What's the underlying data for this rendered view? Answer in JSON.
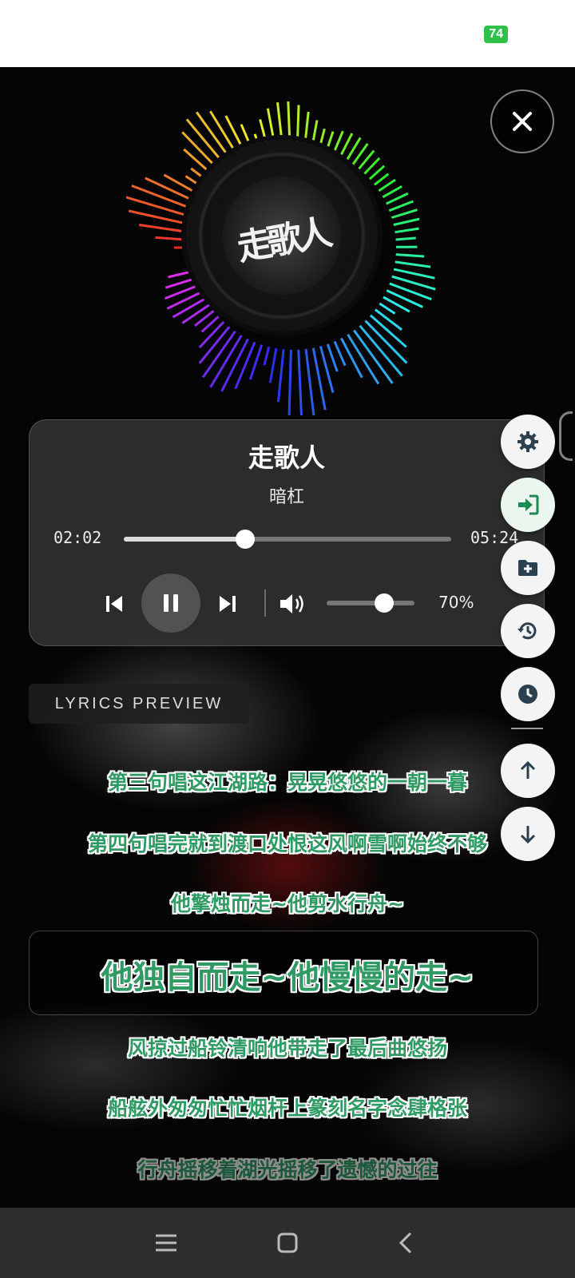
{
  "status_bar": {
    "battery": "74"
  },
  "album_art": {
    "text": "走歌人"
  },
  "player": {
    "title": "走歌人",
    "artist": "暗杠",
    "current_time": "02:02",
    "total_time": "05:24",
    "progress_fraction": 0.37,
    "volume_label": "70%",
    "volume_fraction": 0.65
  },
  "side_actions": [
    "settings",
    "login",
    "add-to-folder",
    "history",
    "timer",
    "scroll-up",
    "scroll-down"
  ],
  "lyrics": {
    "tag": "LYRICS PREVIEW",
    "lines": [
      "第三句唱这江湖路：晃晃悠悠的一朝一暮",
      "第四句唱完就到渡口处恨这风啊雪啊始终不够",
      "他擎烛而走~他剪水行舟~",
      "他独自而走~他慢慢的走~",
      "风掠过船铃清响他带走了最后曲悠扬",
      "船舷外匆匆忙忙烟杆上篆刻名字念肆格张",
      "行舟摇移着湖光摇移了遗憾的过往"
    ],
    "active_index": 3
  },
  "colors": {
    "lyric_green": "#2f9a64",
    "battery_green": "#2ec04a",
    "nav_bg": "#2e2e2e"
  }
}
